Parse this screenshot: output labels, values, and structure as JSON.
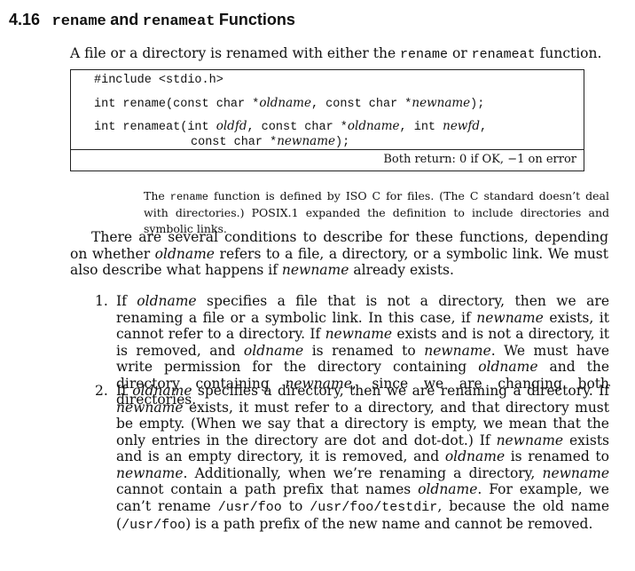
{
  "heading": {
    "number": "4.16",
    "fn1": "rename",
    "and": "and",
    "fn2": "renameat",
    "word": "Functions"
  },
  "intro": {
    "text_a": "A file or a directory is renamed with either the ",
    "code1": "rename",
    "text_b": " or ",
    "code2": "renameat",
    "text_c": " function."
  },
  "code_box": {
    "line1": "#include <stdio.h>",
    "line2_a": "int rename(const char *",
    "line2_b": "oldname",
    "line2_c": ", const char *",
    "line2_d": "newname",
    "line2_e": ");",
    "line3_a": "int renameat(int ",
    "line3_b": "oldfd",
    "line3_c": ", const char *",
    "line3_d": "oldname",
    "line3_e": ", int ",
    "line3_f": "newfd",
    "line3_g": ",",
    "line4_a": "const char *",
    "line4_b": "newname",
    "line4_c": ");",
    "returns": "Both return: 0 if OK, −1 on error"
  },
  "note": {
    "a": "The ",
    "code": "rename",
    "b": " function is defined by ISO C for files. (The C standard doesn’t deal with directories.) POSIX.1 expanded the definition to include directories and symbolic links."
  },
  "paragraph": {
    "a": "There are several conditions to describe for these functions, depending on whether ",
    "i1": "oldname",
    "b": " refers to a file, a directory, or a symbolic link. We must also describe what happens if ",
    "i2": "newname",
    "c": " already exists."
  },
  "item1": {
    "marker": "1.",
    "a": "If ",
    "i1": "oldname",
    "b": " specifies a file that is not a directory, then we are renaming a file or a symbolic link. In this case, if ",
    "i2": "newname",
    "c": " exists, it cannot refer to a directory. If ",
    "i3": "newname",
    "d": " exists and is not a directory, it is removed, and ",
    "i4": "oldname",
    "e": " is renamed to ",
    "i5": "newname",
    "f": ". We must have write permission for the directory containing ",
    "i6": "oldname",
    "g": " and the directory containing ",
    "i7": "newname",
    "h": ", since we are changing both directories."
  },
  "item2": {
    "marker": "2.",
    "a": "If ",
    "i1": "oldname",
    "b": " specifies a directory, then we are renaming a directory. If ",
    "i2": "newname",
    "c": " exists, it must refer to a directory, and that directory must be empty. (When we say that a directory is empty, we mean that the only entries in the directory are dot and dot-dot.) If ",
    "i3": "newname",
    "d": " exists and is an empty directory, it is removed, and ",
    "i4": "oldname",
    "e": " is renamed to ",
    "i5": "newname",
    "f": ". Additionally, when we’re renaming a directory, ",
    "i6": "newname",
    "g": " cannot contain a path prefix that names ",
    "i7": "oldname",
    "h": ". For example, we can’t rename ",
    "code1": "/usr/foo",
    "j": " to ",
    "code2": "/usr/foo/testdir",
    "k": ", because the old name (",
    "code3": "/usr/foo",
    "l": ") is a path prefix of the new name and cannot be removed."
  }
}
